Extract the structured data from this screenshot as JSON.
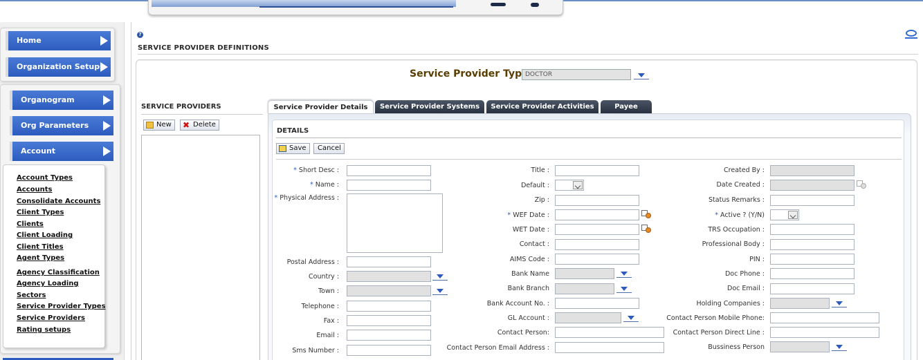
{
  "nav": {
    "top_items": [
      {
        "label": "Home"
      },
      {
        "label": "Organization Setups"
      }
    ],
    "group_items": [
      {
        "label": "Organogram"
      },
      {
        "label": "Org Parameters"
      },
      {
        "label": "Account Management"
      }
    ],
    "links": [
      "Account Types",
      "Accounts",
      "Consolidate Accounts",
      "Client Types",
      "Clients",
      "Client Loading",
      "Client Titles",
      "Agent Types",
      "Agency Classification",
      "Agency Loading",
      "Sectors",
      "Service Provider Types",
      "Service Providers",
      "Rating setups"
    ]
  },
  "page": {
    "title": "SERVICE PROVIDER DEFINITIONS"
  },
  "spt": {
    "label": "Service Provider Type :",
    "value": "DOCTOR"
  },
  "providers": {
    "heading": "SERVICE PROVIDERS",
    "new_label": "New",
    "delete_label": "Delete"
  },
  "tabs": [
    "Service Provider Details",
    "Service Provider Systems",
    "Service Provider Activities",
    "Payee"
  ],
  "details": {
    "heading": "DETAILS",
    "save_label": "Save",
    "cancel_label": "Cancel"
  },
  "form": {
    "col1": [
      "Short Desc :",
      "Name :",
      "Physical Address :",
      "Postal Address :",
      "Country :",
      "Town :",
      "Telephone :",
      "Fax :",
      "Email :",
      "Sms Number :"
    ],
    "col2": [
      "Title :",
      "Default :",
      "Zip :",
      "WEF Date :",
      "WET Date :",
      "Contact :",
      "AIMS Code :",
      "Bank Name",
      "Bank Branch",
      "Bank Account No. :",
      "GL Account :",
      "Contact Person:",
      "Contact Person Email Address :"
    ],
    "col3": [
      "Created By :",
      "Date Created :",
      "Status Remarks :",
      "Active ? (Y/N)",
      "TRS Occupation :",
      "Professional Body :",
      "PIN :",
      "Doc Phone :",
      "Doc Email :",
      "Holding Companies :",
      "Contact Person Mobile Phone:",
      "Contact Person Direct Line :",
      "Bussiness Person"
    ]
  },
  "colors": {
    "nav_blue": "#2c5bbf",
    "tab_dark": "#262f3d",
    "title_brown": "#5a3d00"
  }
}
